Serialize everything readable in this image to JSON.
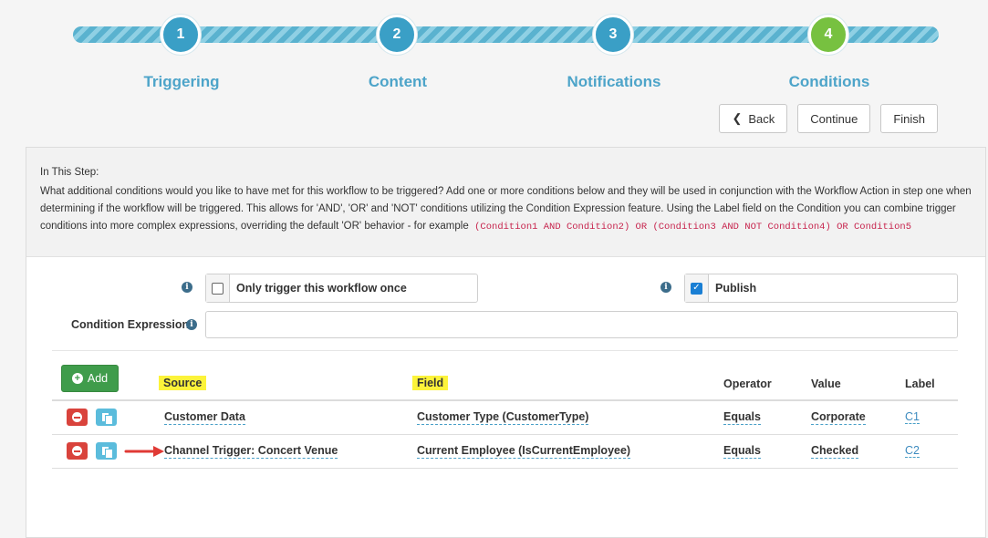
{
  "wizard": {
    "steps": [
      {
        "number": "1",
        "label": "Triggering",
        "state": "done"
      },
      {
        "number": "2",
        "label": "Content",
        "state": "done"
      },
      {
        "number": "3",
        "label": "Notifications",
        "state": "done"
      },
      {
        "number": "4",
        "label": "Conditions",
        "state": "current"
      }
    ],
    "back_label": "Back",
    "continue_label": "Continue",
    "finish_label": "Finish"
  },
  "info": {
    "heading": "In This Step:",
    "text": "What additional conditions would you like to have met for this workflow to be triggered? Add one or more conditions below and they will be used in conjunction with the Workflow Action in step one when determining if the workflow will be triggered. This allows for 'AND', 'OR' and 'NOT' conditions utilizing the Condition Expression feature. Using the Label field on the Condition you can combine trigger conditions into more complex expressions, overriding the default 'OR' behavior - for example",
    "example_code": "(Condition1 AND Condition2) OR (Condition3 AND NOT Condition4) OR Condition5"
  },
  "options": {
    "trigger_once": {
      "label": "Only trigger this workflow once",
      "checked": false
    },
    "publish": {
      "label": "Publish",
      "checked": true
    },
    "expression": {
      "label": "Condition Expression",
      "value": ""
    }
  },
  "conditions": {
    "add_label": "Add",
    "columns": {
      "source": "Source",
      "field": "Field",
      "operator": "Operator",
      "value": "Value",
      "label": "Label"
    },
    "rows": [
      {
        "source": "Customer Data",
        "field": "Customer Type (CustomerType)",
        "operator": "Equals",
        "value": "Corporate",
        "label": "C1"
      },
      {
        "source": "Channel Trigger: Concert Venue",
        "field": "Current Employee (IsCurrentEmployee)",
        "operator": "Equals",
        "value": "Checked",
        "label": "C2"
      }
    ]
  },
  "colors": {
    "step_blue": "#3a9fc6",
    "step_green": "#77c140",
    "highlight": "#fcf33a",
    "add_green": "#3f9c4b",
    "delete_red": "#d9433c",
    "arrow_red": "#e03a35"
  }
}
